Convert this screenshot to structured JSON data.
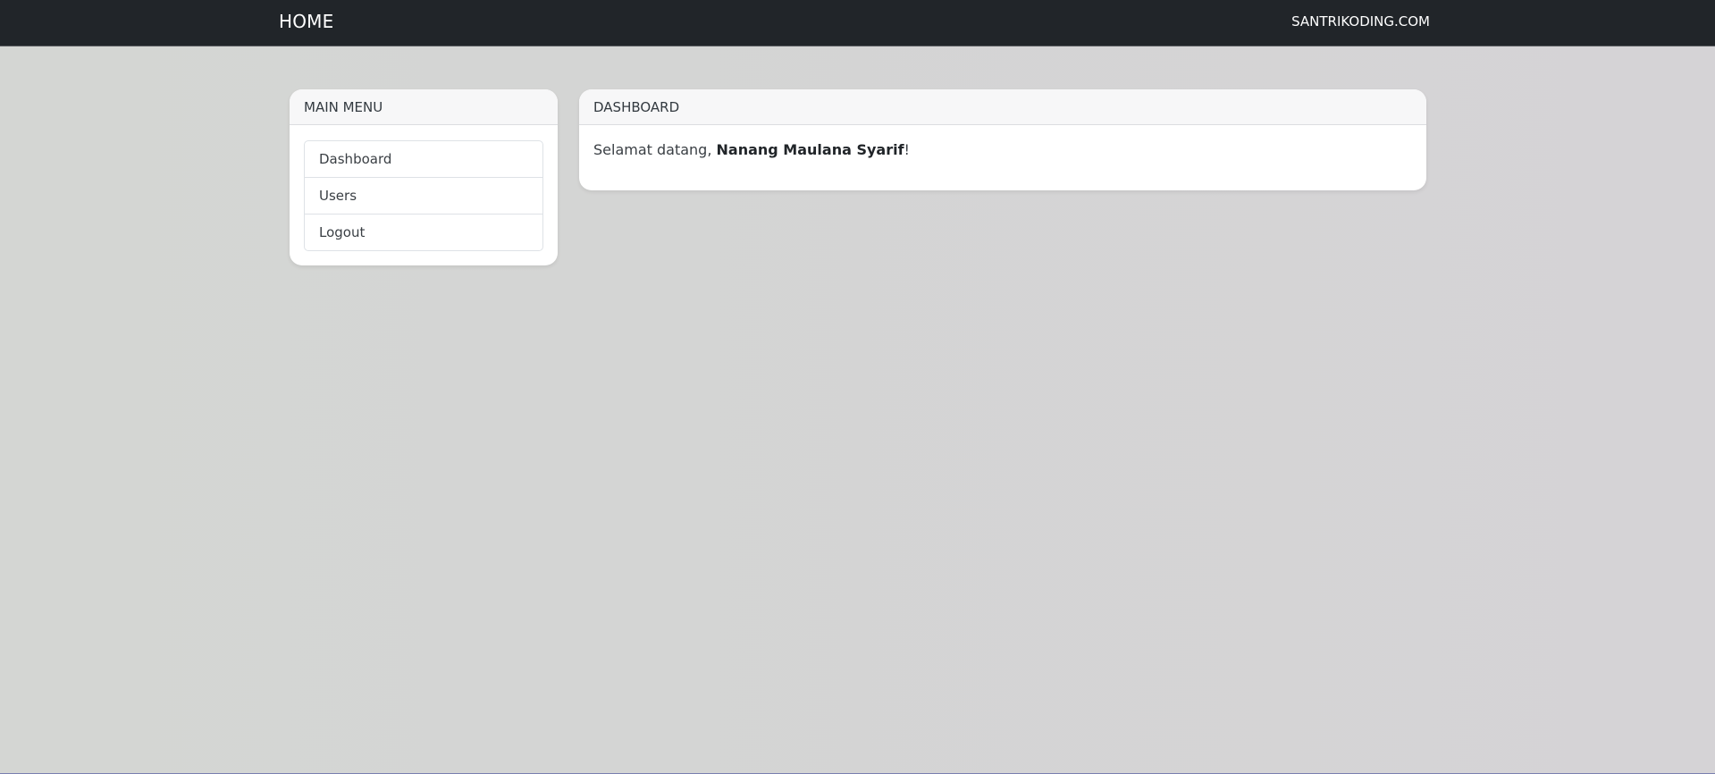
{
  "navbar": {
    "brand": "HOME",
    "right_link": "SANTRIKODING.COM"
  },
  "sidebar": {
    "title": "MAIN MENU",
    "items": [
      {
        "label": "Dashboard"
      },
      {
        "label": "Users"
      },
      {
        "label": "Logout"
      }
    ]
  },
  "main": {
    "title": "DASHBOARD",
    "greeting_prefix": "Selamat datang, ",
    "user_name": "Nanang Maulana Syarif",
    "greeting_suffix": "!"
  },
  "colors": {
    "navbar_bg": "#212529",
    "page_bg": "#d5d5d5",
    "card_bg": "#ffffff",
    "card_header_bg": "#f7f7f8"
  }
}
